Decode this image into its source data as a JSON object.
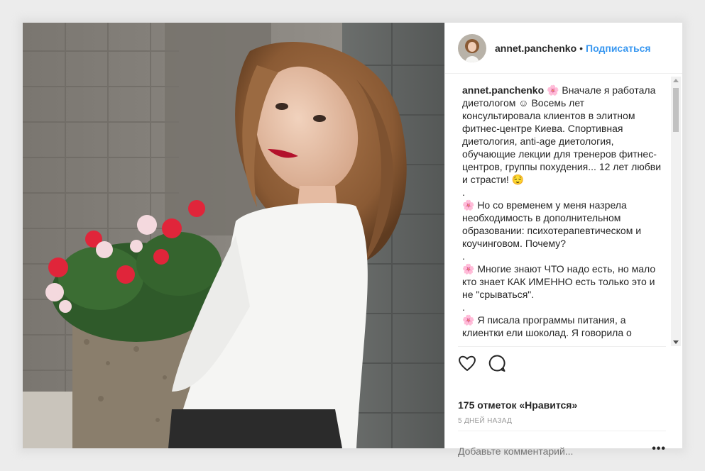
{
  "post": {
    "username": "annet.panchenko",
    "separator": "•",
    "follow_label": "Подписаться",
    "caption_author": "annet.panchenko",
    "caption_body": " 🌸 Вначале я работала диетологом ☺ Восемь лет консультировала клиентов в элитном фитнес-центре Киева. Спортивная диетология, anti-age диетология, обучающие лекции для тренеров фитнес-центров, группы похудения... 12 лет любви и страсти! 😌\n.\n🌸 Но со временем у меня назрела необходимость в дополнительном образовании: психотерапевтическом и коучинговом. Почему?\n.\n🌸 Многие знают ЧТО надо есть, но мало кто знает КАК ИМЕННО есть только это и не \"срываться\".\n.\n🌸 Я писала программы питания, а клиентки ели шоколад. Я говорила о",
    "likes_text": "175 отметок «Нравится»",
    "time_text": "5 ДНЕЙ НАЗАД",
    "comment_placeholder": "Добавьте комментарий...",
    "more_label": "•••"
  },
  "icons": {
    "like": "heart-icon",
    "comment": "speech-bubble-icon"
  },
  "colors": {
    "link": "#3897f0",
    "text": "#262626",
    "muted": "#999999",
    "border": "#efefef"
  }
}
